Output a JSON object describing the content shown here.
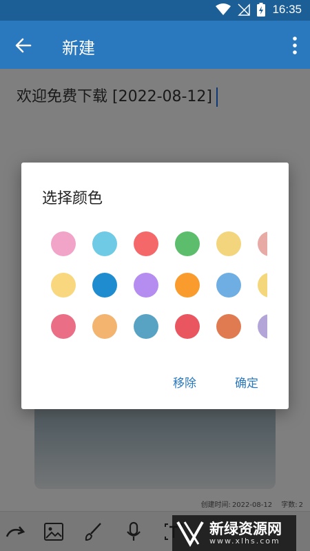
{
  "status_bar": {
    "time": "16:35"
  },
  "app_bar": {
    "title": "新建"
  },
  "note": {
    "title": "欢迎免费下载 [2022-08-12]",
    "created_label": "创建时间:",
    "created_value": "2022-08-12",
    "chars_label": "字数:",
    "chars_value": "2"
  },
  "dialog": {
    "title": "选择颜色",
    "colors": [
      [
        "#f2a3c8",
        "#6fcae6",
        "#f5686a",
        "#5cbd6c",
        "#f2d57c",
        "#e8aaa4"
      ],
      [
        "#f8d77e",
        "#1f8cd0",
        "#b58cf0",
        "#f99c2d",
        "#6faee3",
        "#f4d77a"
      ],
      [
        "#ea6f86",
        "#f2b46f",
        "#58a3c3",
        "#ea5660",
        "#e07a50",
        "#b3a5d8"
      ]
    ],
    "remove_label": "移除",
    "confirm_label": "确定"
  },
  "watermark": {
    "name": "新绿资源网",
    "domain": "www.xlhs.com"
  },
  "theme": {
    "primary": "#2a78bd",
    "status_bar": "#1c5f96"
  }
}
